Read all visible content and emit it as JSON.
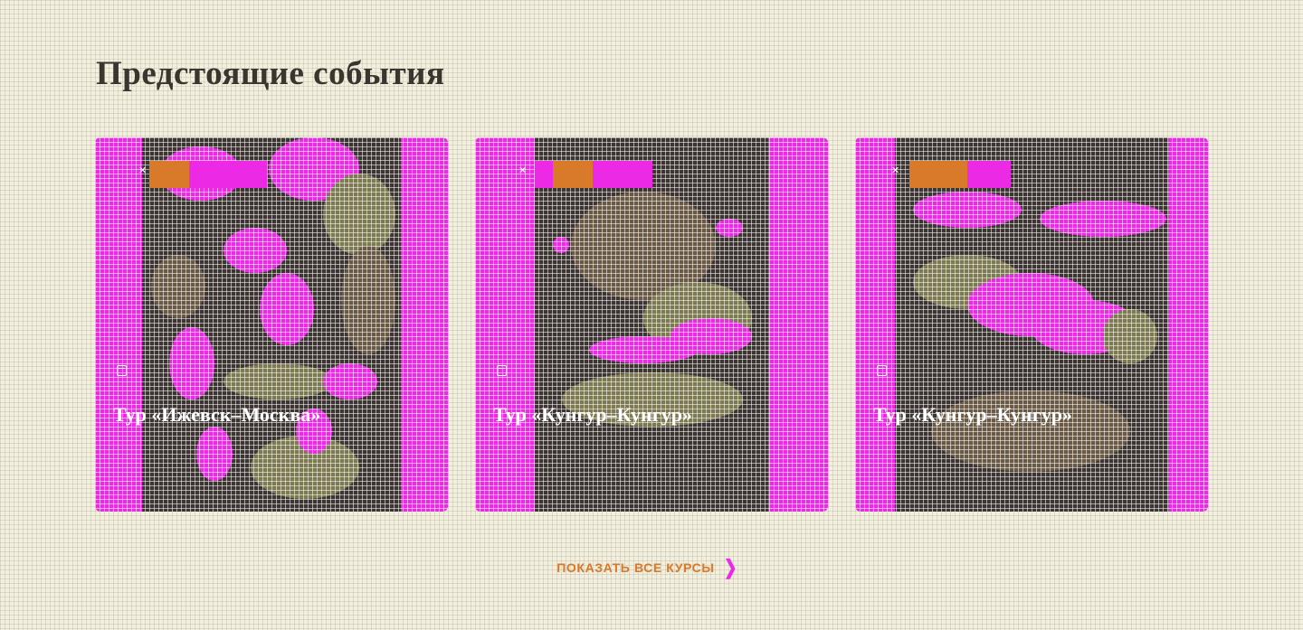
{
  "section": {
    "title": "Предстоящие события"
  },
  "cards": [
    {
      "badge": "",
      "date": "",
      "title": "Тур «Ижевск–Москва»",
      "meta_line1": "",
      "meta_line2": "",
      "meta_right": ""
    },
    {
      "badge": "",
      "date": "",
      "title": "Тур «Кунгур–Кунгур»",
      "meta_line1": "",
      "meta_line2": "",
      "meta_right": ""
    },
    {
      "badge": "",
      "date": "",
      "title": "Тур «Кунгур–Кунгур»",
      "meta_line1": "",
      "meta_line2": "",
      "meta_right": ""
    }
  ],
  "show_all": {
    "label": "ПОКАЗАТЬ ВСЕ КУРСЫ"
  },
  "colors": {
    "background": "#f2efdf",
    "heading": "#3b3530",
    "accent_orange": "#d87a2a",
    "accent_magenta": "#ec2ae6"
  },
  "icons": {
    "date": "calendar-icon",
    "show_all": "chevron-right-icon"
  }
}
